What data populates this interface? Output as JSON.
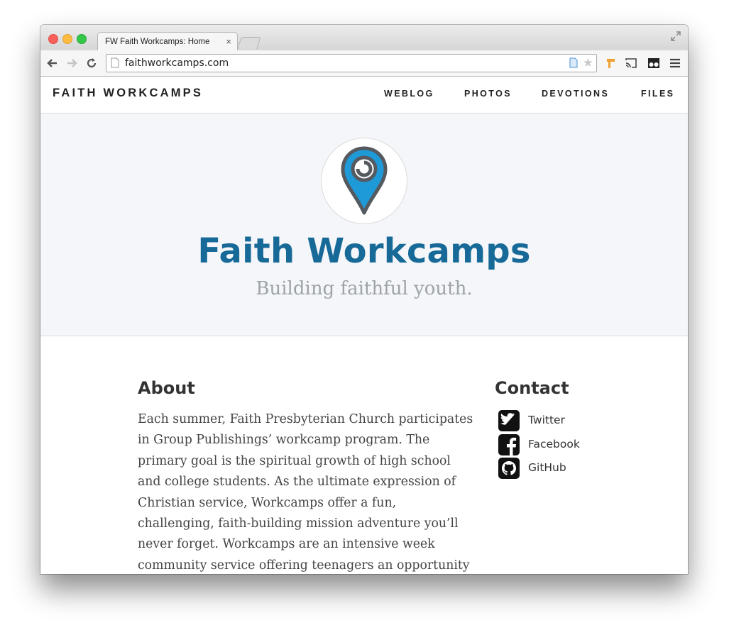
{
  "browser": {
    "tab_title": "FW Faith Workcamps: Home",
    "tab_close": "×",
    "url": "faithworkcamps.com"
  },
  "site": {
    "brand": "FAITH WORKCAMPS",
    "nav": [
      "WEBLOG",
      "PHOTOS",
      "DEVOTIONS",
      "FILES"
    ],
    "hero": {
      "title": "Faith Workcamps",
      "subtitle": "Building faithful youth.",
      "logo": "map-pin-logo-icon"
    },
    "about": {
      "title": "About",
      "body": "Each summer, Faith Presbyterian Church participates in Group Publishings’ workcamp program. The primary goal is the spiritual growth of high school and college students. As the ultimate expression of Christian service, Workcamps offer a fun, challenging, faith-building mission adventure you’ll never forget. Workcamps are an intensive week community service offering teenagers an opportunity to perform hands-on"
    },
    "contact": {
      "title": "Contact",
      "items": [
        {
          "label": "Twitter",
          "icon": "twitter-icon"
        },
        {
          "label": "Facebook",
          "icon": "facebook-icon"
        },
        {
          "label": "GitHub",
          "icon": "github-icon"
        }
      ]
    }
  },
  "colors": {
    "accent": "#176a98",
    "pin_blue": "#1e9ad9",
    "pin_outline": "#555a60",
    "subtitle": "#9da3a8",
    "hero_bg": "#f4f6f9"
  }
}
